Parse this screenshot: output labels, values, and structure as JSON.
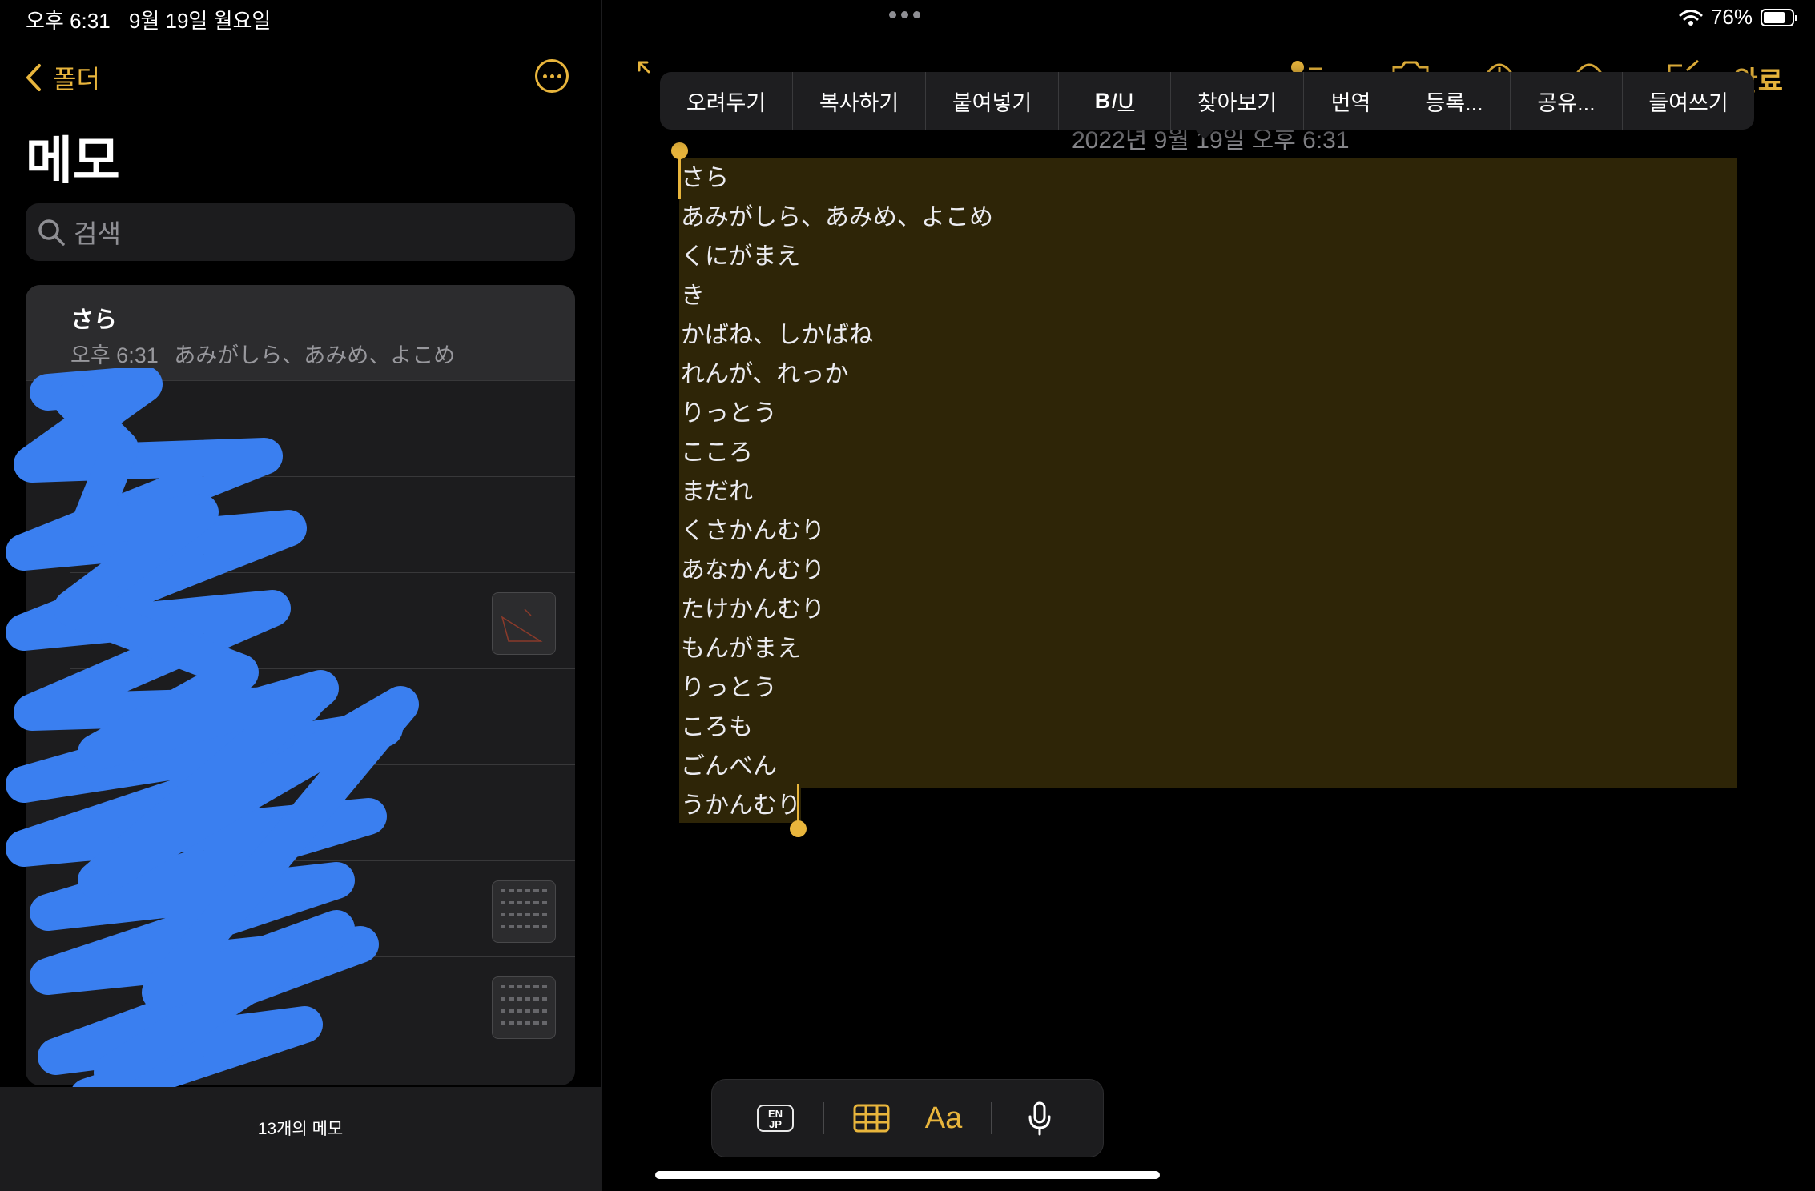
{
  "status_bar": {
    "time": "오후 6:31",
    "date": "9월 19일 월요일",
    "battery": "76%",
    "battery_level": 0.76
  },
  "sidebar": {
    "back_label": "폴더",
    "title": "메모",
    "search_placeholder": "검색",
    "notes": [
      {
        "title": "さら",
        "time": "오후 6:31",
        "preview": "あみがしら、あみめ、よこめ"
      }
    ],
    "footer": "13개의 메모"
  },
  "editor": {
    "done_label": "완료",
    "date_line": "2022년 9월 19일 오후 6:31",
    "context_menu": [
      "오려두기",
      "복사하기",
      "붙여넣기",
      "BIU",
      "찾아보기",
      "번역",
      "등록...",
      "공유...",
      "들여쓰기"
    ],
    "lines": [
      "さら",
      "あみがしら、あみめ、よこめ",
      "くにがまえ",
      "き",
      "かばね、しかばね",
      "れんが、れっか",
      "りっとう",
      "こころ",
      "まだれ",
      "くさかんむり",
      "あなかんむり",
      "たけかんむり",
      "もんがまえ",
      "りっとう",
      "ころも",
      "ごんべん",
      "うかんむり"
    ],
    "keyboard_lang_top": "EN",
    "keyboard_lang_bottom": "JP",
    "format_label": "Aa",
    "accent_color": "#e8b53c"
  }
}
